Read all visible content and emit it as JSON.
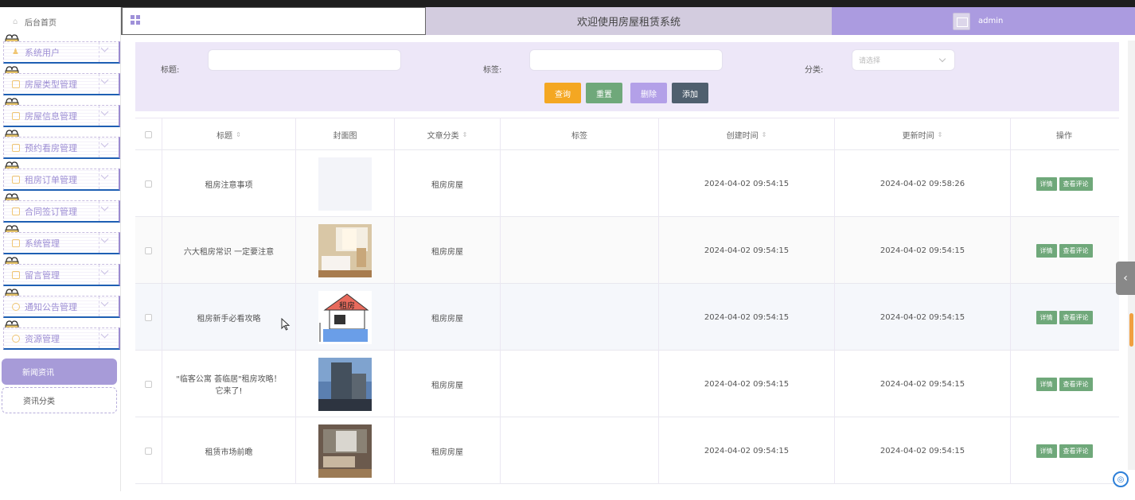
{
  "sidebar": {
    "home": "后台首页",
    "items": [
      {
        "label": "系统用户",
        "icon": "user-icon"
      },
      {
        "label": "房屋类型管理",
        "icon": "folder-icon"
      },
      {
        "label": "房屋信息管理",
        "icon": "folder-icon"
      },
      {
        "label": "预约看房管理",
        "icon": "folder-icon"
      },
      {
        "label": "租房订单管理",
        "icon": "folder-icon"
      },
      {
        "label": "合同签订管理",
        "icon": "folder-icon"
      },
      {
        "label": "系统管理",
        "icon": "folder-icon"
      },
      {
        "label": "留言管理",
        "icon": "folder-icon"
      },
      {
        "label": "通知公告管理",
        "icon": "info-circle-icon"
      },
      {
        "label": "资源管理",
        "icon": "location-icon"
      }
    ],
    "subitems": [
      {
        "label": "新闻资讯",
        "active": true
      },
      {
        "label": "资讯分类",
        "active": false
      }
    ]
  },
  "header": {
    "title": "欢迎使用房屋租赁系统",
    "user": "admin"
  },
  "search": {
    "title_label": "标题:",
    "tag_label": "标签:",
    "category_label": "分类:",
    "category_placeholder": "请选择",
    "buttons": {
      "query": "查询",
      "reset": "重置",
      "delete": "删除",
      "add": "添加"
    }
  },
  "table": {
    "columns": [
      "标题",
      "封面图",
      "文章分类",
      "标签",
      "创建时间",
      "更新时间",
      "操作"
    ],
    "rows": [
      {
        "title": "租房注意事项",
        "category": "租房房屋",
        "tags": "",
        "created": "2024-04-02 09:54:15",
        "updated": "2024-04-02 09:58:26",
        "cover": "blank"
      },
      {
        "title": "六大租房常识 一定要注意",
        "category": "租房房屋",
        "tags": "",
        "created": "2024-04-02 09:54:15",
        "updated": "2024-04-02 09:54:15",
        "cover": "bedroom"
      },
      {
        "title": "租房新手必看攻略",
        "category": "租房房屋",
        "tags": "",
        "created": "2024-04-02 09:54:15",
        "updated": "2024-04-02 09:54:15",
        "cover": "house-sign"
      },
      {
        "title": "\"临客公寓 荟临居\"租房攻略！它来了!",
        "category": "租房房屋",
        "tags": "",
        "created": "2024-04-02 09:54:15",
        "updated": "2024-04-02 09:54:15",
        "cover": "building"
      },
      {
        "title": "租赁市场前瞻",
        "category": "租房房屋",
        "tags": "",
        "created": "2024-04-02 09:54:15",
        "updated": "2024-04-02 09:54:15",
        "cover": "livingroom"
      }
    ],
    "actions": {
      "detail": "详情",
      "comments": "查看评论"
    }
  },
  "colors": {
    "accent": "#ab9be0",
    "panel": "#ede7f8",
    "query": "#f4a722",
    "reset": "#6fa87a",
    "delete": "#b3a0e8",
    "add": "#4f5f6e"
  }
}
